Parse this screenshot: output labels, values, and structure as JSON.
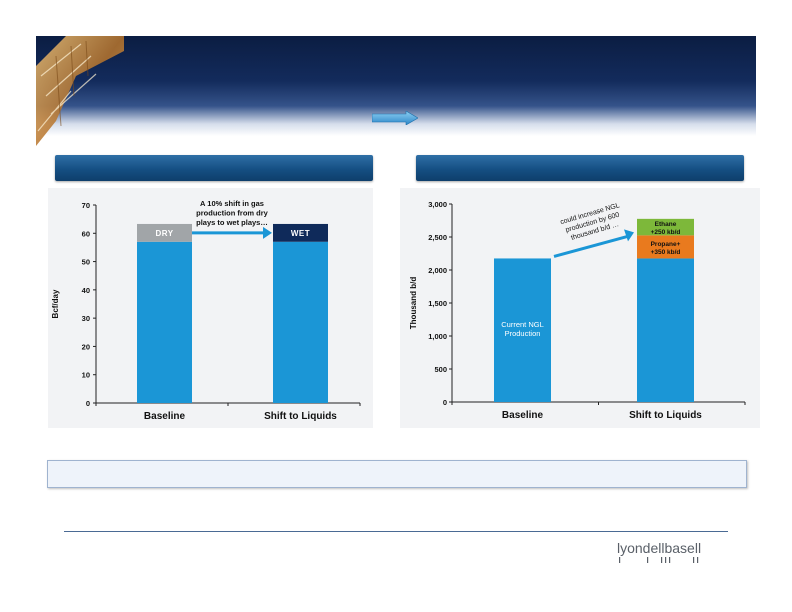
{
  "colors": {
    "base_bar": "#1b96d6",
    "dry": "#a1a5a8",
    "wet": "#0f2a5a",
    "ethane": "#7db83a",
    "propane": "#e97a1e",
    "arrow": "#1b96d6"
  },
  "footer": {
    "logo_text": "lyondellbasell"
  },
  "chart_data": [
    {
      "type": "bar",
      "stacked": true,
      "ylabel": "Bcf/day",
      "xlabel": "",
      "ylim": [
        0,
        70
      ],
      "yticks": [
        "0",
        "10",
        "20",
        "30",
        "40",
        "50",
        "60",
        "70"
      ],
      "categories": [
        "Baseline",
        "Shift to Liquids"
      ],
      "series": [
        {
          "values": [
            57,
            57
          ]
        },
        {
          "name": "DRY",
          "values": [
            6.3,
            0
          ]
        },
        {
          "name": "WET",
          "values": [
            0,
            6.3
          ]
        }
      ],
      "annotation": [
        "A 10% shift in gas",
        "production from dry",
        "plays to wet plays…"
      ],
      "grid": false
    },
    {
      "type": "bar",
      "stacked": true,
      "ylabel": "Thousand b/d",
      "xlabel": "",
      "ylim": [
        0,
        3000
      ],
      "yticks": [
        "0",
        "500",
        "1,000",
        "1,500",
        "2,000",
        "2,500",
        "3,000"
      ],
      "categories": [
        "Baseline",
        "Shift to Liquids"
      ],
      "series": [
        {
          "values": [
            2175,
            2175
          ]
        },
        {
          "values": [
            0,
            350
          ]
        },
        {
          "values": [
            0,
            250
          ]
        }
      ],
      "bar_labels": {
        "base": [
          "Current NGL",
          "Production"
        ],
        "propane": [
          "Propane+",
          "+350 kb/d"
        ],
        "ethane": [
          "Ethane",
          "+250 kb/d"
        ]
      },
      "annotation": [
        "could increase NGL",
        "production by 600",
        "thousand b/d …"
      ],
      "grid": false
    }
  ]
}
